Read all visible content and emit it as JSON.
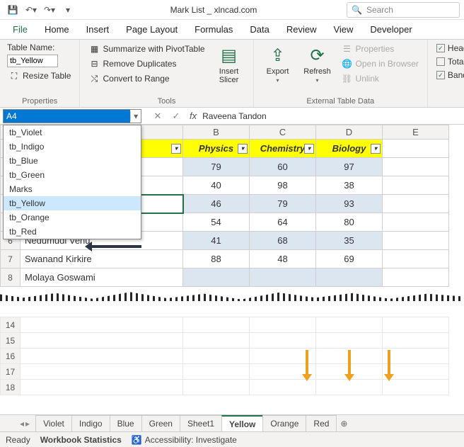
{
  "titlebar": {
    "title": "Mark List _ xlncad.com",
    "search_placeholder": "Search"
  },
  "ribbon_tabs": [
    "File",
    "Home",
    "Insert",
    "Page Layout",
    "Formulas",
    "Data",
    "Review",
    "View",
    "Developer"
  ],
  "ribbon": {
    "table_name_label": "Table Name:",
    "table_name_value": "tb_Yellow",
    "resize_table": "Resize Table",
    "properties_label": "Properties",
    "summarize": "Summarize with PivotTable",
    "remove_dup": "Remove Duplicates",
    "convert_range": "Convert to Range",
    "tools_label": "Tools",
    "insert_slicer": "Insert Slicer",
    "export": "Export",
    "refresh": "Refresh",
    "ext_properties": "Properties",
    "open_browser": "Open in Browser",
    "unlink": "Unlink",
    "external_label": "External Table Data",
    "header_row": "Header Row",
    "total_row": "Total Row",
    "banded_rows": "Banded Rows"
  },
  "namebox": {
    "value": "A4",
    "dropdown": [
      "tb_Violet",
      "tb_Indigo",
      "tb_Blue",
      "tb_Green",
      "Marks",
      "tb_Yellow",
      "tb_Orange",
      "tb_Red"
    ],
    "selected": "tb_Yellow"
  },
  "formula": {
    "text": "Raveena Tandon"
  },
  "grid": {
    "col_letters": [
      "B",
      "C",
      "D",
      "E"
    ],
    "headers": [
      "Physics",
      "Chemistry",
      "Biology"
    ],
    "rows": [
      {
        "n": "",
        "name": "",
        "vals": [
          "79",
          "60",
          "97"
        ],
        "alt": false
      },
      {
        "n": "",
        "name": "",
        "vals": [
          "40",
          "98",
          "38"
        ],
        "alt": true
      },
      {
        "n": "",
        "name": "",
        "vals": [
          "46",
          "79",
          "93"
        ],
        "alt": false,
        "active": true
      },
      {
        "n": "",
        "name": "",
        "vals": [
          "54",
          "64",
          "80"
        ],
        "alt": true
      },
      {
        "n": "6",
        "name": "Nedumudi Venu",
        "vals": [
          "41",
          "68",
          "35"
        ],
        "alt": false
      },
      {
        "n": "7",
        "name": "Swanand Kirkire",
        "vals": [
          "88",
          "48",
          "69"
        ],
        "alt": true
      },
      {
        "n": "8",
        "name": "Molaya Goswami",
        "vals": [
          "",
          "",
          ""
        ],
        "alt": false,
        "torn": true
      }
    ],
    "lower_rows": [
      "14",
      "15",
      "16",
      "17",
      "18"
    ]
  },
  "sheets": [
    "Violet",
    "Indigo",
    "Blue",
    "Green",
    "Sheet1",
    "Yellow",
    "Orange",
    "Red"
  ],
  "active_sheet": "Yellow",
  "status": {
    "ready": "Ready",
    "stats": "Workbook Statistics",
    "acc": "Accessibility: Investigate"
  }
}
